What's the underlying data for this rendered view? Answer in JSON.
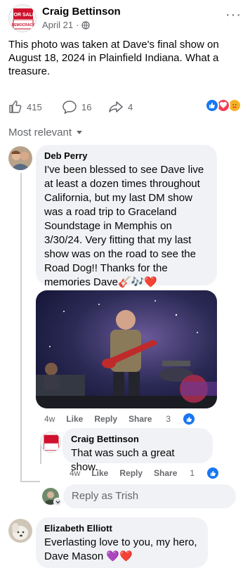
{
  "post": {
    "author": "Craig Bettinson",
    "date": "April 21",
    "separator": "·",
    "text": "This photo was taken at Dave's final show on August 18, 2024 in Plainfield Indiana. What a treasure.",
    "more": "···",
    "avatar_sign": [
      "FOR SALE",
      "DEMOCRACY"
    ]
  },
  "reactions": {
    "like_count": "415",
    "comment_count": "16",
    "share_count": "4"
  },
  "sort": {
    "label": "Most relevant"
  },
  "comments": [
    {
      "name": "Deb Perry",
      "text": "I've been blessed to see Dave live at least a dozen times throughout California, but my last DM show was a road trip to Graceland Soundstage in Memphis on 3/30/24. Very fitting that my last show was on the road to see the Road Dog!! Thanks for the memories Dave🎸🎶❤️",
      "time": "4w",
      "like": "Like",
      "reply": "Reply",
      "share": "Share",
      "likes": "3"
    },
    {
      "name": "Craig Bettinson",
      "text": "That was such a great show.",
      "time": "4w",
      "like": "Like",
      "reply": "Reply",
      "share": "Share",
      "likes": "1"
    },
    {
      "name": "Elizabeth Elliott",
      "text": "Everlasting love to you, my hero, Dave Mason 💜❤️"
    }
  ],
  "reply_input": {
    "placeholder": "Reply as Trish"
  },
  "colors": {
    "accent": "#1877f2",
    "bubble": "#f0f2f5",
    "muted": "#65676b"
  }
}
